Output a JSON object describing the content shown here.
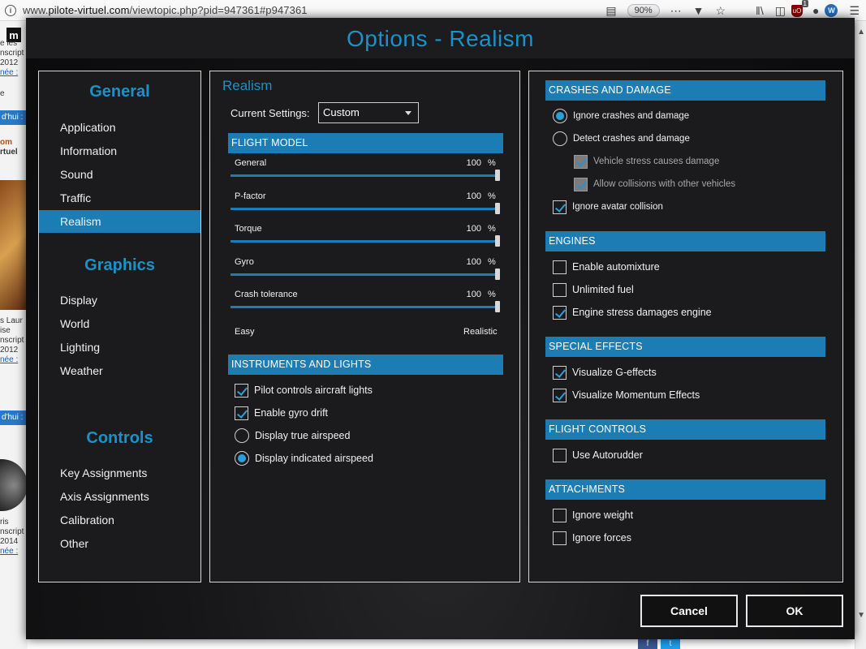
{
  "browser": {
    "url_prefix": "www.",
    "url_host": "pilote-virtuel.com",
    "url_path": "/viewtopic.php?pid=947361#p947361",
    "zoom": "90%",
    "ublock_count": "1",
    "ublock_label": "uO",
    "ext_label": "W"
  },
  "background_page": {
    "logo": "m",
    "strip1": "d'hui :",
    "strip2": "d'hui :",
    "lines_a": [
      "e les",
      "nscript",
      "2012",
      "née :",
      "",
      "e"
    ],
    "lines_b": [
      "om",
      "rtuel"
    ],
    "lines_c": [
      "s Laur",
      "ise",
      "nscript",
      "2012",
      "née :"
    ],
    "lines_d": [
      "ris",
      "nscript",
      "2014",
      "née :"
    ]
  },
  "dialog": {
    "title": "Options - Realism"
  },
  "nav": {
    "sections": [
      {
        "title": "General",
        "items": [
          "Application",
          "Information",
          "Sound",
          "Traffic",
          "Realism"
        ]
      },
      {
        "title": "Graphics",
        "items": [
          "Display",
          "World",
          "Lighting",
          "Weather"
        ]
      },
      {
        "title": "Controls",
        "items": [
          "Key Assignments",
          "Axis Assignments",
          "Calibration",
          "Other"
        ]
      }
    ],
    "active": "Realism"
  },
  "realism": {
    "title": "Realism",
    "current_settings_label": "Current Settings:",
    "current_settings_value": "Custom",
    "flight_model": {
      "header": "FLIGHT MODEL",
      "sliders": [
        {
          "label": "General",
          "value": "100",
          "unit": "%",
          "fraction": 1.0
        },
        {
          "label": "P-factor",
          "value": "100",
          "unit": "%",
          "fraction": 1.0
        },
        {
          "label": "Torque",
          "value": "100",
          "unit": "%",
          "fraction": 1.0
        },
        {
          "label": "Gyro",
          "value": "100",
          "unit": "%",
          "fraction": 1.0
        },
        {
          "label": "Crash tolerance",
          "value": "100",
          "unit": "%",
          "fraction": 1.0
        }
      ],
      "scale_min": "Easy",
      "scale_max": "Realistic"
    },
    "instruments": {
      "header": "INSTRUMENTS AND LIGHTS",
      "options": [
        {
          "type": "checkbox",
          "label": "Pilot controls aircraft lights",
          "checked": true
        },
        {
          "type": "checkbox",
          "label": "Enable gyro drift",
          "checked": true
        },
        {
          "type": "radio",
          "label": "Display true airspeed",
          "checked": false
        },
        {
          "type": "radio",
          "label": "Display indicated airspeed",
          "checked": true
        }
      ]
    }
  },
  "crashes": {
    "header": "CRASHES AND DAMAGE",
    "ignore": "Ignore crashes and damage",
    "detect": "Detect crashes and damage",
    "stress": "Vehicle stress causes damage",
    "collisions": "Allow collisions with other vehicles",
    "avatar": "Ignore avatar collision"
  },
  "engines": {
    "header": "ENGINES",
    "automixture": "Enable automixture",
    "fuel": "Unlimited fuel",
    "stress": "Engine stress damages engine"
  },
  "effects": {
    "header": "SPECIAL EFFECTS",
    "gforce": "Visualize G-effects",
    "momentum": "Visualize Momentum Effects"
  },
  "flight_controls": {
    "header": "FLIGHT CONTROLS",
    "autorudder": "Use Autorudder"
  },
  "attachments": {
    "header": "ATTACHMENTS",
    "weight": "Ignore weight",
    "forces": "Ignore forces"
  },
  "buttons": {
    "cancel": "Cancel",
    "ok": "OK"
  },
  "colors": {
    "accent": "#1c7db4",
    "title_blue": "#1a92c8",
    "check_blue": "#2aa0da"
  }
}
